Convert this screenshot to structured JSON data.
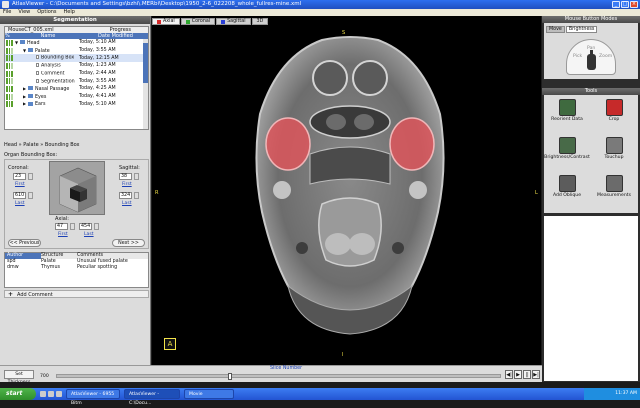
{
  "window": {
    "title": "AtlasViewer - C:\\Documents and Settings\\bzhi\\.MERbi\\Desktop\\1950_2-6_022208_whole_fullres-mine.xml"
  },
  "menu": [
    "File",
    "View",
    "Options",
    "Help"
  ],
  "left_panel": {
    "header": "Segmentation",
    "file_name": "MouseCT_005.xml",
    "progress_label": "Progress",
    "columns": {
      "name": "Name",
      "date": "Date Modified"
    },
    "tree": [
      {
        "name": "Head",
        "date": "Today, 5:10 AM",
        "depth": 0,
        "kind": "folder",
        "twisty": "▼"
      },
      {
        "name": "Palate",
        "date": "Today, 3:55 AM",
        "depth": 1,
        "kind": "folder",
        "twisty": "▼"
      },
      {
        "name": "Bounding Box",
        "date": "Today, 12:15 AM",
        "depth": 2,
        "kind": "doc",
        "twisty": ""
      },
      {
        "name": "Analysis",
        "date": "Today, 1:23 AM",
        "depth": 2,
        "kind": "doc",
        "twisty": ""
      },
      {
        "name": "Comment",
        "date": "Today, 2:44 AM",
        "depth": 2,
        "kind": "doc",
        "twisty": ""
      },
      {
        "name": "Segmentation",
        "date": "Today, 3:55 AM",
        "depth": 2,
        "kind": "doc",
        "twisty": ""
      },
      {
        "name": "Nasal Passage",
        "date": "Today, 4:25 AM",
        "depth": 1,
        "kind": "folder",
        "twisty": "▶"
      },
      {
        "name": "Eyes",
        "date": "Today, 4:41 AM",
        "depth": 1,
        "kind": "folder",
        "twisty": "▶"
      },
      {
        "name": "Ears",
        "date": "Today, 5:10 AM",
        "depth": 1,
        "kind": "folder",
        "twisty": "▶"
      }
    ],
    "breadcrumb": "Head » Palate » Bounding Box",
    "bbox_title": "Organ Bounding Box:",
    "coronal": {
      "label": "Coronal:",
      "first": "23",
      "last": "610",
      "first_link": "First",
      "last_link": "Last"
    },
    "sagittal": {
      "label": "Sagittal:",
      "first": "38",
      "last": "324",
      "first_link": "First",
      "last_link": "Last"
    },
    "axial": {
      "label": "Axial:",
      "first": "47",
      "last": "454",
      "first_link": "First",
      "last_link": "Last"
    },
    "prev_button": "<< Previous",
    "next_button": "Next >>",
    "annotations": {
      "columns": [
        "Author",
        "Structure",
        "Comments"
      ],
      "rows": [
        [
          "spd",
          "Palate",
          "Unusual fused palate"
        ],
        [
          "dmw",
          "Thymus",
          "Peculiar spotting"
        ]
      ]
    },
    "add_comment": "Add Comment"
  },
  "viewer": {
    "tabs": [
      {
        "label": "Axial",
        "color": "#d62a2a",
        "active": true
      },
      {
        "label": "Coronal",
        "color": "#2fa82f",
        "active": false
      },
      {
        "label": "Sagittal",
        "color": "#2a3fd6",
        "active": false
      },
      {
        "label": "3D",
        "color": "",
        "active": false
      }
    ],
    "orientation": {
      "top": "S",
      "bottom": "I",
      "left": "R",
      "right": "L"
    },
    "view_icon": "A",
    "highlight_color": "#e4545a"
  },
  "right_panel": {
    "header": "Mouse Button Modes",
    "mode_tabs": [
      "Move",
      "Brightness"
    ],
    "mouse_labels": {
      "left": "Pick",
      "center": "Pan",
      "right": "Zoom"
    },
    "tools_header": "Tools",
    "tools": [
      {
        "label": "Reorient Data",
        "icon": "reorient-icon"
      },
      {
        "label": "Crop",
        "icon": "crop-icon"
      },
      {
        "label": "Brightness/Contrast",
        "icon": "brightness-icon"
      },
      {
        "label": "Touchup",
        "icon": "touchup-icon"
      },
      {
        "label": "Add Oblique",
        "icon": "oblique-icon"
      },
      {
        "label": "Measurements",
        "icon": "ruler-icon"
      }
    ]
  },
  "bottom": {
    "slice_label": "Slice Number",
    "set_thickness": "Set Thickness",
    "slice_value": "700",
    "slider_fraction": 0.39,
    "playback": [
      "◀|",
      "▶",
      "||",
      "▶|"
    ]
  },
  "taskbar": {
    "start": "start",
    "tasks": [
      "AtlasViewer - 6955 Bitm",
      "AtlasViewer - C:\\Docu...",
      "Movie"
    ],
    "time": "11:37 AM"
  }
}
